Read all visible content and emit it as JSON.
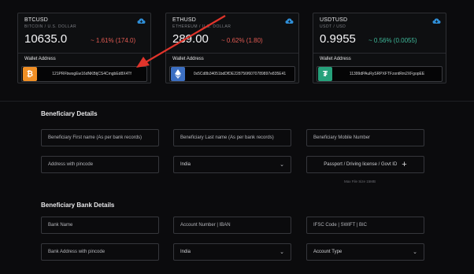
{
  "cards": [
    {
      "symbol": "BTCUSD",
      "desc": "BITCOIN / U.S. DOLLAR",
      "price": "10635.0",
      "change": "~ 1.61% (174.0)",
      "change_dir": "neg",
      "wallet_label": "Wallet Address",
      "address": "121PRFbwsgEw16dNKBtjCS4CmgbEd8X4Tf",
      "coin_icon": "bitcoin-icon",
      "coin_color": "#f08f25"
    },
    {
      "symbol": "ETHUSD",
      "desc": "ETHEREUM / U.S. DOLLAR",
      "price": "289.00",
      "change": "~ 0.62% (1.80)",
      "change_dir": "neg",
      "wallet_label": "Wallet Address",
      "address": "0x5Cd8b34051bdDfDE228756f6070789897e835E41",
      "coin_icon": "ethereum-icon",
      "coin_color": "#3c6fc2"
    },
    {
      "symbol": "USDTUSD",
      "desc": "USDT / USD",
      "price": "0.9955",
      "change": "~ 0.56% (0.0055)",
      "change_dir": "pos",
      "wallet_label": "Wallet Address",
      "address": "11399dPAuRySRPXFTFzxntRm2XFgopEE",
      "coin_icon": "tether-icon",
      "coin_color": "#26a17b"
    }
  ],
  "beneficiary": {
    "title": "Beneficiary Details",
    "first_name": "Beneficiary First name (As per bank records)",
    "last_name": "Beneficiary Last name (As per bank records)",
    "mobile": "Beneficiary Mobile Number",
    "address": "Address with pincode",
    "country": "India",
    "id_upload": "Passport / Driving license / Govt ID",
    "max_size": "Max File Size 15MB"
  },
  "bank": {
    "title": "Beneficiary Bank Details",
    "bank_name": "Bank Name",
    "account_number": "Account Number | IBAN",
    "ifsc": "IFSC Code | SWIFT | BIC",
    "bank_address": "Bank Address with pincode",
    "country": "India",
    "account_type": "Account Type"
  },
  "colors": {
    "negative": "#e15a52",
    "positive": "#3fb99a",
    "annotation_arrow": "#e0342b",
    "cloud_icon": "#2f8fd8"
  }
}
